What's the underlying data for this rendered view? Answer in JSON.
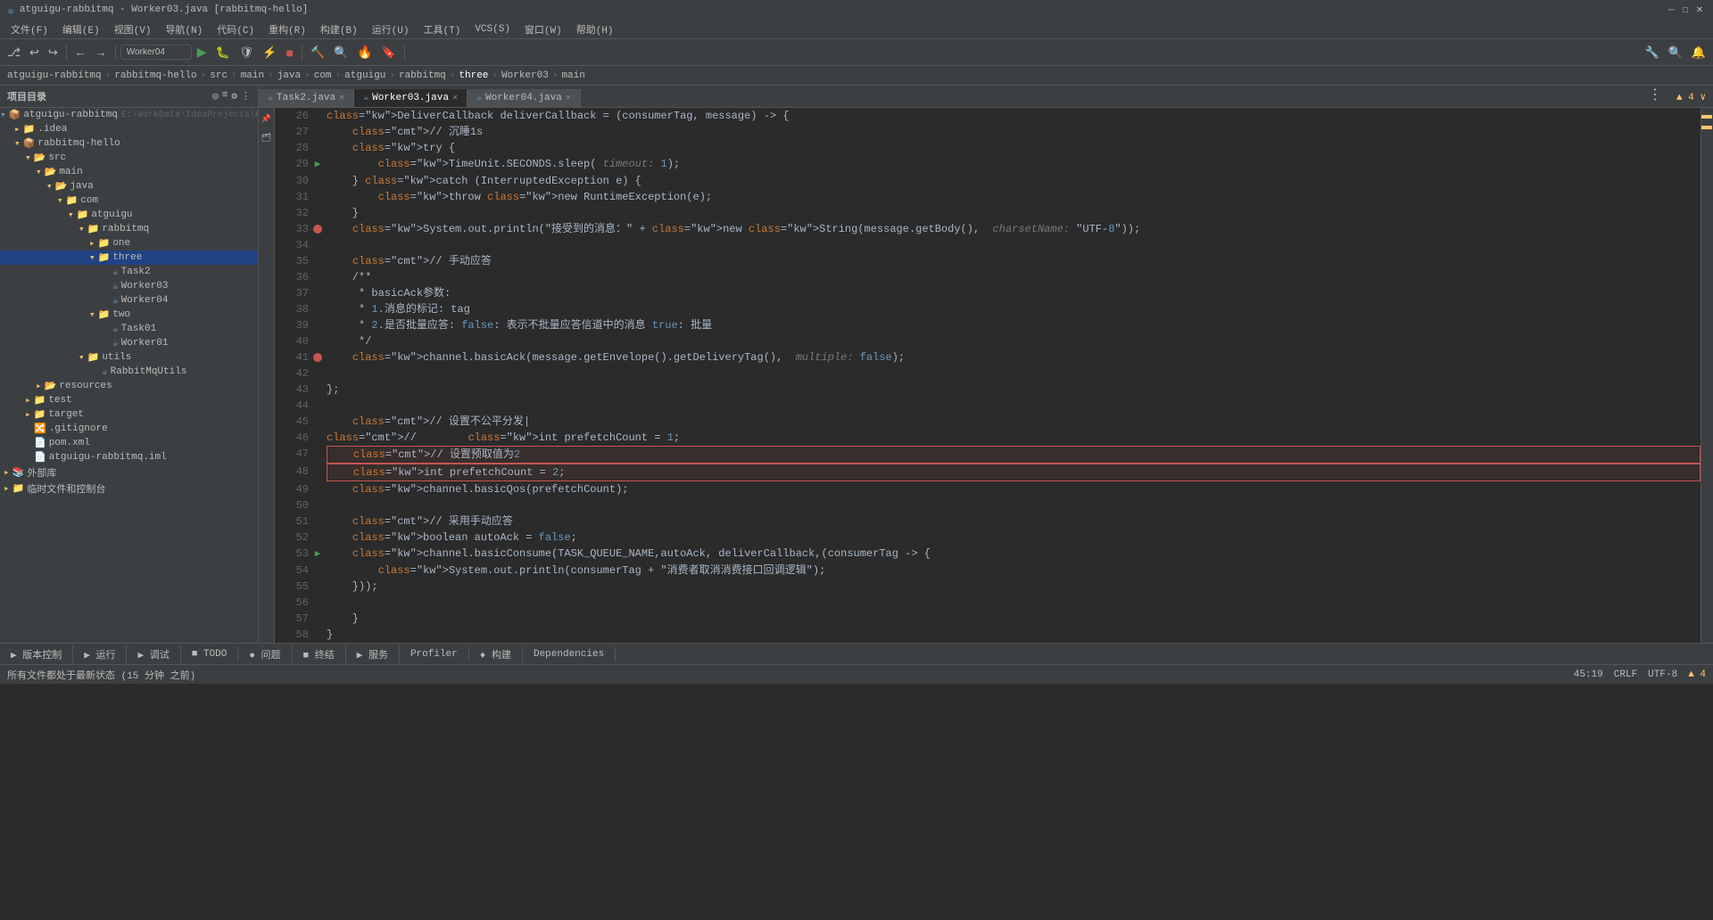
{
  "window": {
    "title": "atguigu-rabbitmq - Worker03.java [rabbitmq-hello]",
    "menu_items": [
      "文件(F)",
      "编辑(E)",
      "视图(V)",
      "导航(N)",
      "代码(C)",
      "重构(R)",
      "构建(B)",
      "运行(U)",
      "工具(T)",
      "VCS(S)",
      "窗口(W)",
      "帮助(H)"
    ]
  },
  "toolbar": {
    "profile_selector": "Worker04",
    "buttons": [
      "undo",
      "redo",
      "git",
      "run",
      "stop",
      "build",
      "search"
    ]
  },
  "breadcrumb": {
    "items": [
      "atguigu-rabbitmq",
      "rabbitmq-hello",
      "src",
      "main",
      "java",
      "com",
      "atguigu",
      "rabbitmq",
      "three",
      "Worker03",
      "main"
    ]
  },
  "tabs": {
    "items": [
      {
        "label": "Task2.java",
        "active": false,
        "icon": "java"
      },
      {
        "label": "Worker03.java",
        "active": true,
        "icon": "java"
      },
      {
        "label": "Worker04.java",
        "active": false,
        "icon": "java"
      }
    ],
    "more_button": "⋮"
  },
  "file_tree": {
    "panel_title": "项目目录",
    "items": [
      {
        "label": "atguigu-rabbitmq",
        "level": 0,
        "type": "module",
        "expanded": true
      },
      {
        "label": ".idea",
        "level": 1,
        "type": "folder",
        "expanded": false
      },
      {
        "label": "rabbitmq-hello",
        "level": 1,
        "type": "module",
        "expanded": true
      },
      {
        "label": "src",
        "level": 2,
        "type": "folder",
        "expanded": true
      },
      {
        "label": "main",
        "level": 3,
        "type": "folder",
        "expanded": true
      },
      {
        "label": "java",
        "level": 4,
        "type": "folder",
        "expanded": true
      },
      {
        "label": "com",
        "level": 5,
        "type": "folder",
        "expanded": true
      },
      {
        "label": "atguigu",
        "level": 6,
        "type": "folder",
        "expanded": true
      },
      {
        "label": "rabbitmq",
        "level": 7,
        "type": "folder",
        "expanded": true
      },
      {
        "label": "one",
        "level": 8,
        "type": "folder",
        "expanded": false
      },
      {
        "label": "three",
        "level": 8,
        "type": "folder",
        "expanded": true,
        "selected": true
      },
      {
        "label": "Task2",
        "level": 9,
        "type": "java"
      },
      {
        "label": "Worker03",
        "level": 9,
        "type": "java"
      },
      {
        "label": "Worker04",
        "level": 9,
        "type": "java"
      },
      {
        "label": "two",
        "level": 8,
        "type": "folder",
        "expanded": true
      },
      {
        "label": "Task01",
        "level": 9,
        "type": "java"
      },
      {
        "label": "Worker01",
        "level": 9,
        "type": "java"
      },
      {
        "label": "utils",
        "level": 7,
        "type": "folder",
        "expanded": true
      },
      {
        "label": "RabbitMqUtils",
        "level": 8,
        "type": "java"
      },
      {
        "label": "resources",
        "level": 3,
        "type": "folder",
        "expanded": false
      },
      {
        "label": "test",
        "level": 2,
        "type": "folder",
        "expanded": false
      },
      {
        "label": "target",
        "level": 2,
        "type": "folder",
        "expanded": false
      },
      {
        "label": ".gitignore",
        "level": 2,
        "type": "git"
      },
      {
        "label": "pom.xml",
        "level": 2,
        "type": "xml"
      },
      {
        "label": "atguigu-rabbitmq.iml",
        "level": 2,
        "type": "iml"
      },
      {
        "label": "外部库",
        "level": 0,
        "type": "folder",
        "expanded": false
      },
      {
        "label": "临时文件和控制台",
        "level": 0,
        "type": "folder",
        "expanded": false
      }
    ]
  },
  "code": {
    "lines": [
      {
        "num": 26,
        "content": "DeliverCallback deliverCallback = (consumerTag, message) -> {",
        "gutter": ""
      },
      {
        "num": 27,
        "content": "    // 沉睡1s",
        "gutter": ""
      },
      {
        "num": 28,
        "content": "    try {",
        "gutter": ""
      },
      {
        "num": 29,
        "content": "        TimeUnit.SECONDS.sleep( timeout: 1);",
        "gutter": "run"
      },
      {
        "num": 30,
        "content": "    } catch (InterruptedException e) {",
        "gutter": ""
      },
      {
        "num": 31,
        "content": "        throw new RuntimeException(e);",
        "gutter": ""
      },
      {
        "num": 32,
        "content": "    }",
        "gutter": ""
      },
      {
        "num": 33,
        "content": "    System.out.println(\"接受到的消息：\" + new String(message.getBody(),  charsetName: \"UTF-8\"));",
        "gutter": "breakpoint"
      },
      {
        "num": 34,
        "content": "",
        "gutter": ""
      },
      {
        "num": 35,
        "content": "    // 手动应答",
        "gutter": ""
      },
      {
        "num": 36,
        "content": "    /**",
        "gutter": ""
      },
      {
        "num": 37,
        "content": "     * basicAck参数:",
        "gutter": ""
      },
      {
        "num": 38,
        "content": "     * 1.消息的标记: tag",
        "gutter": ""
      },
      {
        "num": 39,
        "content": "     * 2.是否批量应答: false: 表示不批量应答信道中的消息 true: 批量",
        "gutter": ""
      },
      {
        "num": 40,
        "content": "     */",
        "gutter": ""
      },
      {
        "num": 41,
        "content": "    channel.basicAck(message.getEnvelope().getDeliveryTag(),  multiple: false);",
        "gutter": "breakpoint"
      },
      {
        "num": 42,
        "content": "",
        "gutter": ""
      },
      {
        "num": 43,
        "content": "};",
        "gutter": ""
      },
      {
        "num": 44,
        "content": "",
        "gutter": ""
      },
      {
        "num": 45,
        "content": "    // 设置不公平分发|",
        "gutter": ""
      },
      {
        "num": 46,
        "content": "//        int prefetchCount = 1;",
        "gutter": ""
      },
      {
        "num": 47,
        "content": "    // 设置预取值为2",
        "gutter": "",
        "redbox": true
      },
      {
        "num": 48,
        "content": "    int prefetchCount = 2;",
        "gutter": "",
        "redbox": true
      },
      {
        "num": 49,
        "content": "    channel.basicQos(prefetchCount);",
        "gutter": ""
      },
      {
        "num": 50,
        "content": "",
        "gutter": ""
      },
      {
        "num": 51,
        "content": "    // 采用手动应答",
        "gutter": ""
      },
      {
        "num": 52,
        "content": "    boolean autoAck = false;",
        "gutter": ""
      },
      {
        "num": 53,
        "content": "    channel.basicConsume(TASK_QUEUE_NAME,autoAck, deliverCallback,(consumerTag -> {",
        "gutter": "run"
      },
      {
        "num": 54,
        "content": "        System.out.println(consumerTag + \"消费者取消消费接口回调逻辑\");",
        "gutter": ""
      },
      {
        "num": 55,
        "content": "    }));",
        "gutter": ""
      },
      {
        "num": 56,
        "content": "",
        "gutter": ""
      },
      {
        "num": 57,
        "content": "    }",
        "gutter": ""
      },
      {
        "num": 58,
        "content": "}",
        "gutter": ""
      }
    ]
  },
  "bottom_tabs": [
    {
      "label": "▶ 版本控制",
      "active": false
    },
    {
      "label": "▶ 运行",
      "active": false
    },
    {
      "label": "▶ 调试",
      "active": false
    },
    {
      "label": "■ TODO",
      "active": false
    },
    {
      "label": "● 问题",
      "active": false
    },
    {
      "label": "■ 终结",
      "active": false
    },
    {
      "label": "▶ 服务",
      "active": false
    },
    {
      "label": "Profiler",
      "active": false
    },
    {
      "label": "♦ 构建",
      "active": false
    },
    {
      "label": "Dependencies",
      "active": false
    }
  ],
  "status_bar": {
    "left": "所有文件都处于最新状态 (15 分钟 之前)",
    "right_position": "45:19",
    "right_crlf": "CRLF",
    "right_encoding": "UTF-8",
    "right_warnings": "▲ 4"
  }
}
